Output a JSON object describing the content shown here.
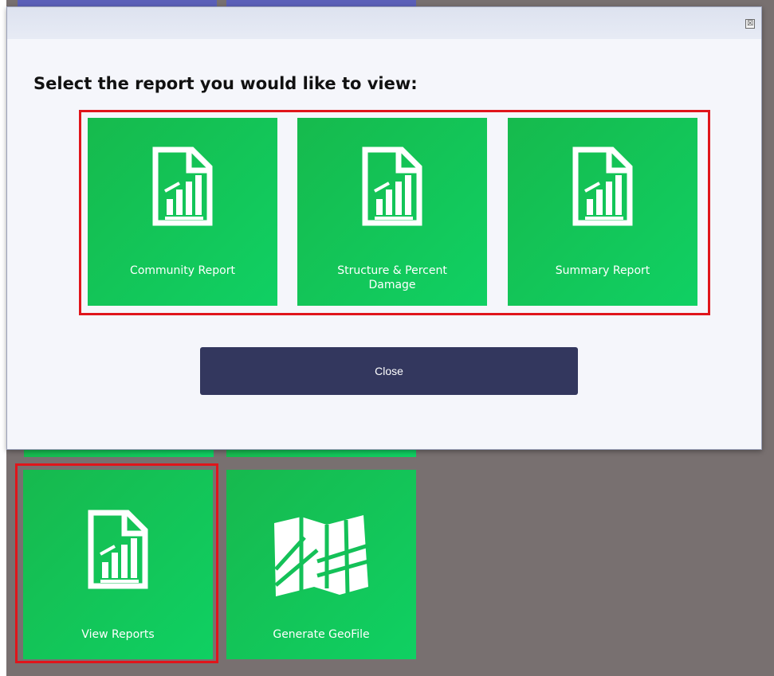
{
  "dialog": {
    "title": "Select the report you would like to view:",
    "close_glyph": "☒",
    "reports": [
      {
        "label": "Community Report",
        "icon": "report-chart-icon"
      },
      {
        "label": "Structure & Percent Damage",
        "icon": "report-chart-icon"
      },
      {
        "label": "Summary Report",
        "icon": "report-chart-icon"
      }
    ],
    "close_label": "Close"
  },
  "main_tiles": [
    {
      "label": "View Reports",
      "icon": "report-chart-icon"
    },
    {
      "label": "Generate GeoFile",
      "icon": "map-icon"
    }
  ],
  "colors": {
    "tile_green": "#14c158",
    "close_button": "#33375e",
    "highlight_red": "#e0151b",
    "background": "#787070"
  }
}
